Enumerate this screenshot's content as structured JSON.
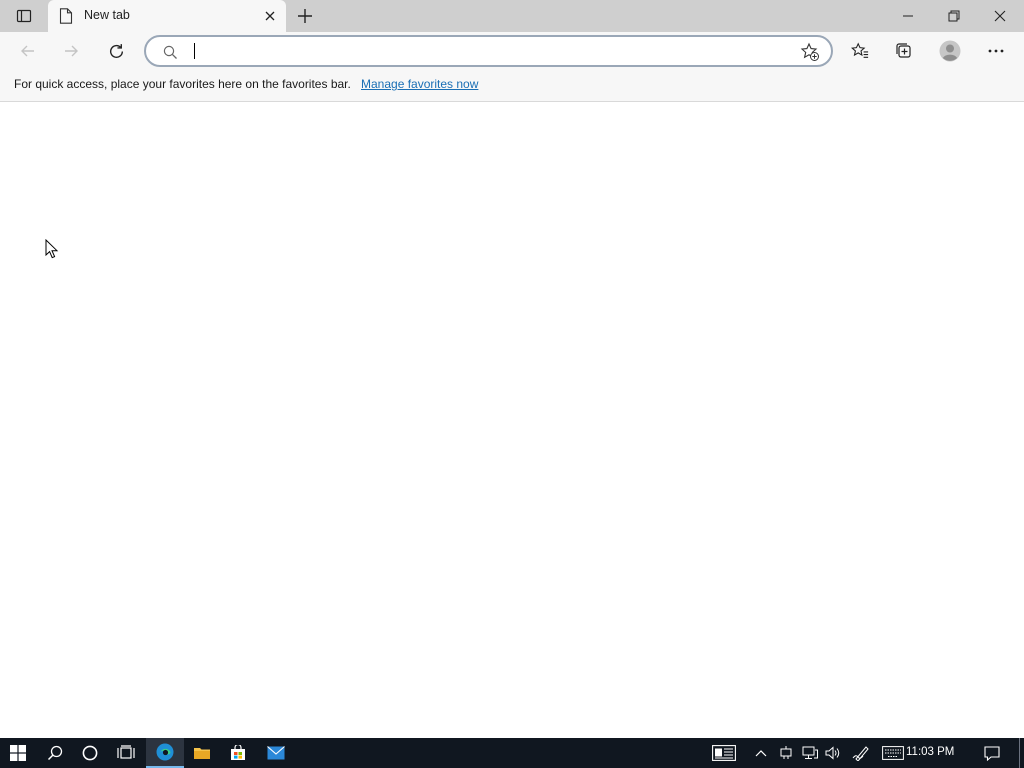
{
  "tab": {
    "title": "New tab"
  },
  "address_bar": {
    "value": "",
    "placeholder": ""
  },
  "favorites_bar": {
    "message": "For quick access, place your favorites here on the favorites bar.",
    "link": "Manage favorites now"
  },
  "taskbar": {
    "clock": "11:03 PM"
  },
  "colors": {
    "tabstrip": "#cfcfcf",
    "toolbar": "#f7f7f7",
    "link": "#1a6fb5",
    "taskbar": "#101720",
    "edge_accent": "#76b9ed"
  },
  "icons": [
    "tab-actions-icon",
    "page-icon",
    "close-tab-icon",
    "new-tab-icon",
    "minimize-icon",
    "restore-icon",
    "close-window-icon",
    "back-icon",
    "forward-icon",
    "refresh-icon",
    "search-icon",
    "add-favorite-icon",
    "favorites-icon",
    "collections-icon",
    "profile-icon",
    "more-icon",
    "windows-start-icon",
    "taskbar-search-icon",
    "cortana-icon",
    "task-view-icon",
    "edge-icon",
    "file-explorer-icon",
    "store-icon",
    "mail-icon",
    "news-icon",
    "chevron-up-icon",
    "network-icon",
    "volume-icon",
    "pen-icon",
    "keyboard-icon",
    "notifications-icon"
  ]
}
